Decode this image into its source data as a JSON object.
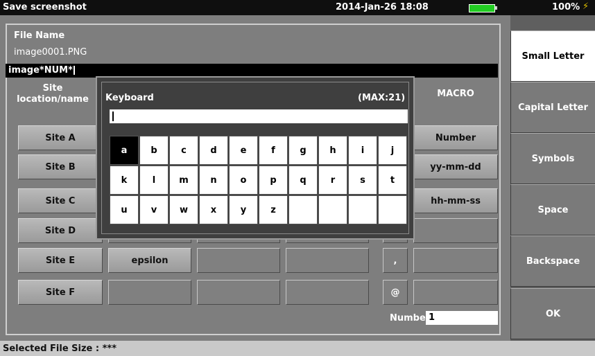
{
  "titlebar": {
    "title": "Save screenshot",
    "datetime": "2014-Jan-26 18:08",
    "battery_percent": "100%",
    "battery_icon": "battery-full-icon",
    "plug_icon": "power-plug-icon",
    "battery_color": "#22cc22"
  },
  "file": {
    "label": "File Name",
    "current": "image0001.PNG",
    "input_value": "image*NUM*"
  },
  "headers": {
    "site_line1": "Site",
    "site_line2": "location/name",
    "macro": "MACRO"
  },
  "sites": [
    "Site A",
    "Site B",
    "Site C",
    "Site D",
    "Site E",
    "Site F"
  ],
  "row_e": {
    "name": "epsilon",
    "symbol": ","
  },
  "row_f": {
    "symbol": "@"
  },
  "macros": [
    "Number",
    "yy-mm-dd",
    "hh-mm-ss"
  ],
  "number": {
    "label": "Number",
    "value": "1"
  },
  "keyboard": {
    "title": "Keyboard",
    "max": "(MAX:21)",
    "input_value": "",
    "selected_key": "a",
    "rows": [
      [
        "a",
        "b",
        "c",
        "d",
        "e",
        "f",
        "g",
        "h",
        "i",
        "j"
      ],
      [
        "k",
        "l",
        "m",
        "n",
        "o",
        "p",
        "q",
        "r",
        "s",
        "t"
      ],
      [
        "u",
        "v",
        "w",
        "x",
        "y",
        "z",
        "",
        "",
        "",
        ""
      ]
    ]
  },
  "sidebar": {
    "items": [
      "Small Letter",
      "Capital Letter",
      "Symbols",
      "Space",
      "Backspace",
      "OK"
    ],
    "active": "Small Letter"
  },
  "status": {
    "text": "Selected File Size : ***"
  }
}
